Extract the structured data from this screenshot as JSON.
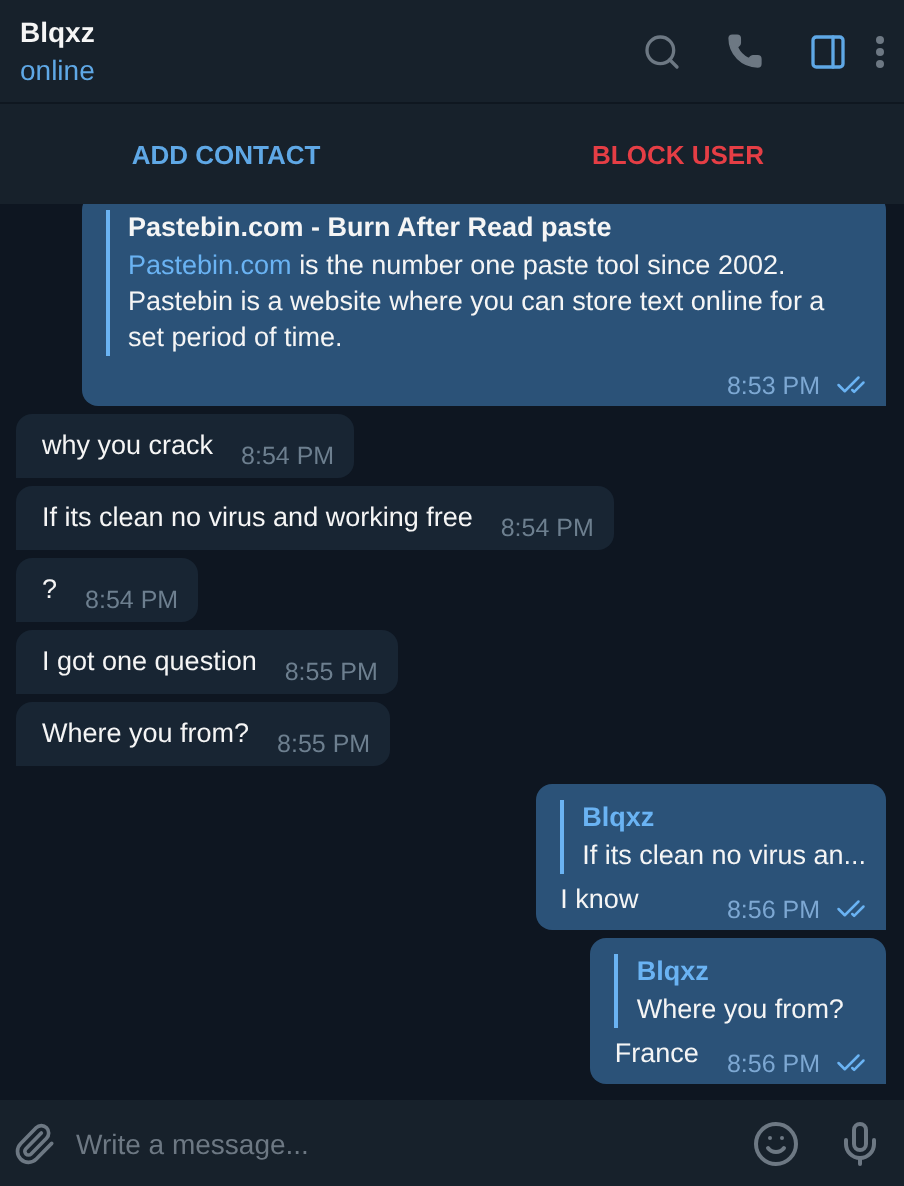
{
  "header": {
    "name": "Blqxz",
    "status": "online",
    "panel_active": true
  },
  "actions": [
    {
      "label": "ADD CONTACT",
      "kind": "add"
    },
    {
      "label": "BLOCK USER",
      "kind": "block"
    }
  ],
  "messages": [
    {
      "kind": "outgoing",
      "preview": {
        "title": "Pastebin.com - Burn After Read paste",
        "link": "Pastebin.com",
        "description": "is the number one paste tool since 2002. Pastebin is a website where you can store text online for a set period of time."
      },
      "time": "8:53 PM",
      "read": true
    },
    {
      "kind": "incoming",
      "text": "why you crack",
      "time": "8:54 PM"
    },
    {
      "kind": "incoming",
      "text": "If its clean no virus and working free",
      "time": "8:54 PM"
    },
    {
      "kind": "incoming",
      "text": "?",
      "time": "8:54 PM"
    },
    {
      "kind": "incoming",
      "text": "I got one question",
      "time": "8:55 PM"
    },
    {
      "kind": "incoming",
      "text": "Where you from?",
      "time": "8:55 PM"
    },
    {
      "kind": "outgoing",
      "reply": {
        "author": "Blqxz",
        "text": "If its clean no virus an..."
      },
      "text": "I know",
      "time": "8:56 PM",
      "read": true
    },
    {
      "kind": "outgoing",
      "reply": {
        "author": "Blqxz",
        "text": "Where you from?"
      },
      "text": "France",
      "time": "8:56 PM",
      "read": true
    }
  ],
  "composer": {
    "placeholder": "Write a message..."
  }
}
